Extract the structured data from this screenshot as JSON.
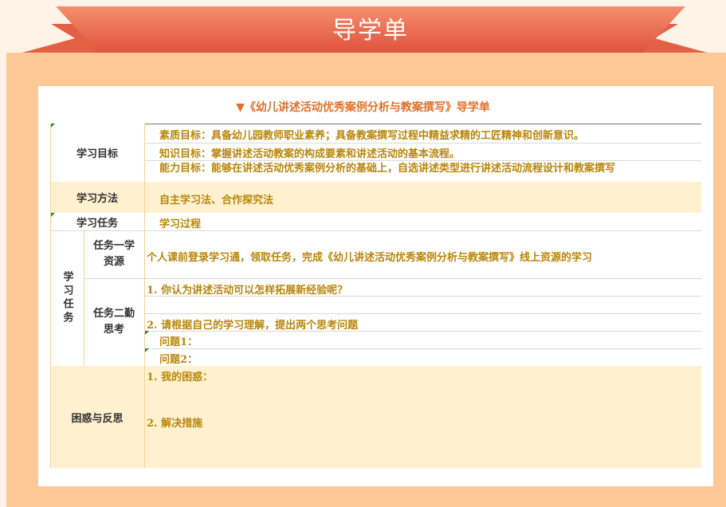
{
  "header": {
    "banner_title": "导学单"
  },
  "document": {
    "title": "▼《幼儿讲述活动优秀案例分析与教案撰写》导学单",
    "objectives": {
      "label": "学习目标",
      "lines": [
        "素质目标：具备幼儿园教师职业素养；具备教案撰写过程中精益求精的工匠精神和创新意识。",
        "知识目标：掌握讲述活动教案的构成要素和讲述活动的基本流程。",
        "能力目标：能够在讲述活动优秀案例分析的基础上，自选讲述类型进行讲述活动流程设计和教案撰写"
      ]
    },
    "method": {
      "label": "学习方法",
      "value": "自主学习法、合作探究法"
    },
    "tasks_header": {
      "label": "学习任务",
      "value": "学习过程"
    },
    "tasks_side_label": "学习任务",
    "task1": {
      "label": "任务一学资源",
      "text": "个人课前登录学习通，领取任务，完成《幼儿讲述活动优秀案例分析与教案撰写》线上资源的学习"
    },
    "task2": {
      "label": "任务二勤思考",
      "q1": "1. 你认为讲述活动可以怎样拓展新经验呢？",
      "q2": "2. 请根据自己的学习理解，提出两个思考问题",
      "p1": "问题1：",
      "p2": "问题2："
    },
    "reflection": {
      "label": "困惑与反思",
      "item1": "1. 我的困惑：",
      "item2": "2. 解决措施"
    }
  }
}
